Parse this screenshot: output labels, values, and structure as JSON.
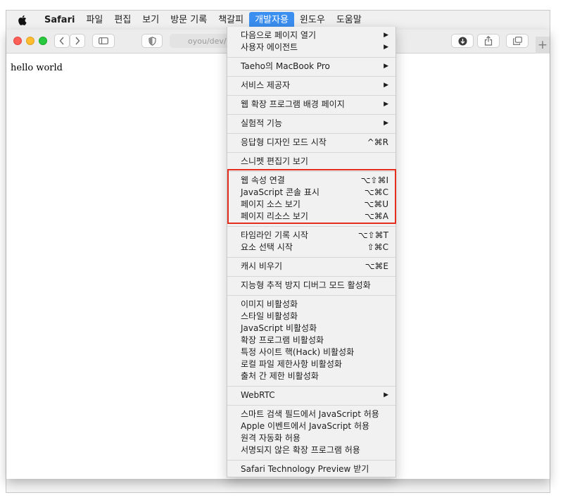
{
  "menubar": {
    "app_name": "Safari",
    "items": [
      "파일",
      "편집",
      "보기",
      "방문 기록",
      "책갈피",
      "개발자용",
      "윈도우",
      "도움말"
    ],
    "active_index": 5
  },
  "toolbar": {
    "address_text": "oyou/dev/V"
  },
  "page": {
    "body_text": "hello world"
  },
  "dropdown": {
    "g1": [
      {
        "label": "다음으로 페이지 열기",
        "submenu": true
      },
      {
        "label": "사용자 에이전트",
        "submenu": true
      }
    ],
    "g2": [
      {
        "label": "Taeho의 MacBook Pro",
        "submenu": true
      }
    ],
    "g3": [
      {
        "label": "서비스 제공자",
        "submenu": true
      }
    ],
    "g4": [
      {
        "label": "웹 확장 프로그램 배경 페이지",
        "submenu": true
      }
    ],
    "g5": [
      {
        "label": "실험적 기능",
        "submenu": true
      }
    ],
    "g6": [
      {
        "label": "응답형 디자인 모드 시작",
        "shortcut": "^⌘R"
      }
    ],
    "g7": [
      {
        "label": "스니펫 편집기 보기"
      }
    ],
    "g8": [
      {
        "label": "웹 속성 연결",
        "shortcut": "⌥⇧⌘I"
      },
      {
        "label": "JavaScript 콘솔 표시",
        "shortcut": "⌥⌘C"
      },
      {
        "label": "페이지 소스 보기",
        "shortcut": "⌥⌘U"
      },
      {
        "label": "페이지 리소스 보기",
        "shortcut": "⌥⌘A"
      }
    ],
    "g9": [
      {
        "label": "타임라인 기록 시작",
        "shortcut": "⌥⇧⌘T"
      },
      {
        "label": "요소 선택 시작",
        "shortcut": "⇧⌘C"
      }
    ],
    "g10": [
      {
        "label": "캐시 비우기",
        "shortcut": "⌥⌘E"
      }
    ],
    "g11": [
      {
        "label": "지능형 추적 방지 디버그 모드 활성화"
      }
    ],
    "g12": [
      {
        "label": "이미지 비활성화"
      },
      {
        "label": "스타일 비활성화"
      },
      {
        "label": "JavaScript 비활성화"
      },
      {
        "label": "확장 프로그램 비활성화"
      },
      {
        "label": "특정 사이트 핵(Hack) 비활성화"
      },
      {
        "label": "로컬 파일 제한사항 비활성화"
      },
      {
        "label": "출처 간 제한 비활성화"
      }
    ],
    "g13": [
      {
        "label": "WebRTC",
        "submenu": true
      }
    ],
    "g14": [
      {
        "label": "스마트 검색 필드에서 JavaScript 허용"
      },
      {
        "label": "Apple 이벤트에서 JavaScript 허용"
      },
      {
        "label": "원격 자동화 허용"
      },
      {
        "label": "서명되지 않은 확장 프로그램 허용"
      }
    ],
    "g15": [
      {
        "label": "Safari Technology Preview 받기"
      }
    ]
  },
  "colors": {
    "menu_active": "#3b8ff0",
    "highlight_box": "#e52d1e"
  }
}
